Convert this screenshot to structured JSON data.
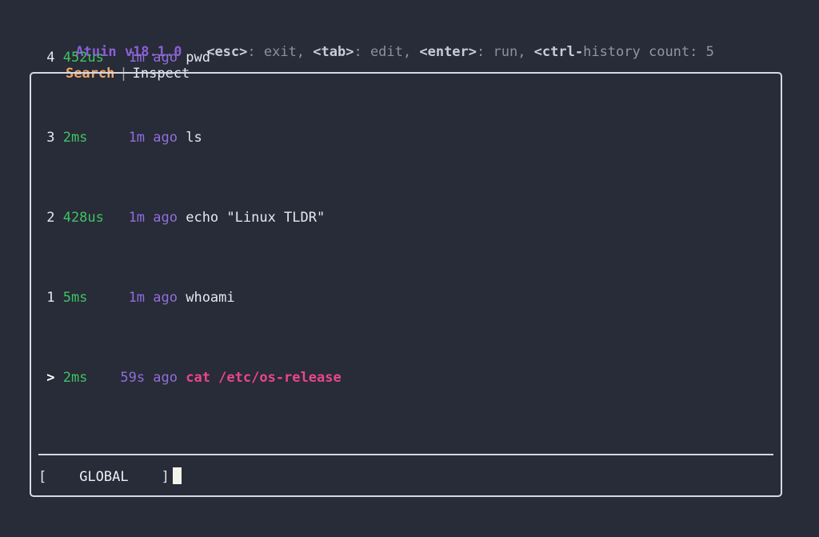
{
  "app": {
    "name": "Atuin",
    "version": "v18.1.0",
    "brand_color": "#8b5fd6",
    "background_color": "#282b38",
    "border_color": "#d6d9e4"
  },
  "header": {
    "title": "Atuin v18.1.0",
    "keys": [
      {
        "key": "<esc>",
        "action": ": exit, "
      },
      {
        "key": "<tab>",
        "action": ": edit, "
      },
      {
        "key": "<enter>",
        "action": ": run, "
      },
      {
        "key": "<ctrl-",
        "action": ""
      }
    ],
    "history_count_label": "history count: 5",
    "raw_help": "<esc>: exit, <tab>: edit, <enter>: run, <ctrl-"
  },
  "tabs": {
    "active": "Search",
    "separator": "|",
    "items": [
      {
        "label": "Search",
        "active": true
      },
      {
        "label": "Inspect",
        "active": false
      }
    ]
  },
  "history": {
    "rows": [
      {
        "index": "4",
        "duration": "452us",
        "time": "1m ago",
        "command": "pwd",
        "selected": false
      },
      {
        "index": "3",
        "duration": "2ms",
        "time": "1m ago",
        "command": "ls",
        "selected": false
      },
      {
        "index": "2",
        "duration": "428us",
        "time": "1m ago",
        "command": "echo \"Linux TLDR\"",
        "selected": false
      },
      {
        "index": "1",
        "duration": "5ms",
        "time": "1m ago",
        "command": "whoami",
        "selected": false
      },
      {
        "index": ">",
        "duration": "2ms",
        "time": "59s ago",
        "command": "cat /etc/os-release",
        "selected": true
      }
    ],
    "colors": {
      "duration": "#3fc463",
      "time": "#8f6fd8",
      "command": "#e6e8f0",
      "selected_command": "#e8468c"
    }
  },
  "statusbar": {
    "open_bracket": "[",
    "filter_mode": "GLOBAL",
    "close_bracket": "]",
    "search_value": "",
    "search_placeholder": ""
  }
}
